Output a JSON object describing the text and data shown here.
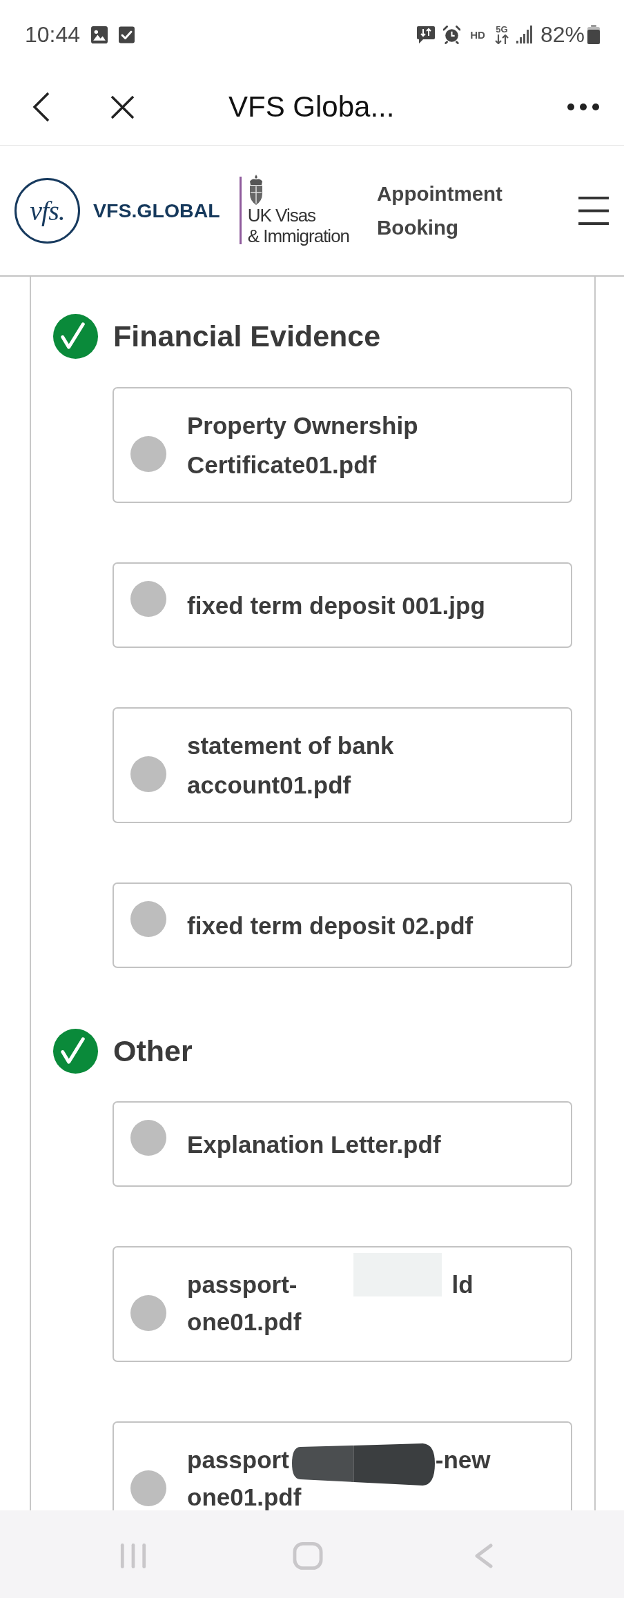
{
  "status_bar": {
    "time": "10:44",
    "hd_label": "HD",
    "network_label": "5G",
    "battery": "82%"
  },
  "browser_bar": {
    "title": "VFS Globa..."
  },
  "site_header": {
    "logo_mark": "vfs.",
    "logo_name": "VFS.GLOBAL",
    "partner_lines": [
      "UK Visas",
      "& Immigration"
    ],
    "title_lines": [
      "Appointment",
      "Booking"
    ]
  },
  "sections": [
    {
      "title": "Financial Evidence",
      "complete": true,
      "files": [
        {
          "kind": "plain",
          "lines": [
            "Property Ownership",
            "Certificate01.pdf"
          ],
          "selected": false
        },
        {
          "kind": "plain",
          "lines": [
            "fixed term deposit 001.jpg"
          ],
          "selected": false
        },
        {
          "kind": "plain",
          "lines": [
            "statement of bank",
            "account01.pdf"
          ],
          "selected": false
        },
        {
          "kind": "plain",
          "lines": [
            "fixed term deposit 02.pdf"
          ],
          "selected": false
        }
      ]
    },
    {
      "title": "Other",
      "complete": true,
      "files": [
        {
          "kind": "plain",
          "lines": [
            "Explanation Letter.pdf"
          ],
          "selected": false
        },
        {
          "kind": "redacted",
          "start": "passport-",
          "redaction": {
            "kind": "pale"
          },
          "end": "ld",
          "last_line": "one01.pdf",
          "selected": false
        },
        {
          "kind": "redacted",
          "start": "passport",
          "redaction": {
            "kind": "dark"
          },
          "end": "-new",
          "last_line": "one01.pdf",
          "selected": false
        }
      ]
    }
  ]
}
